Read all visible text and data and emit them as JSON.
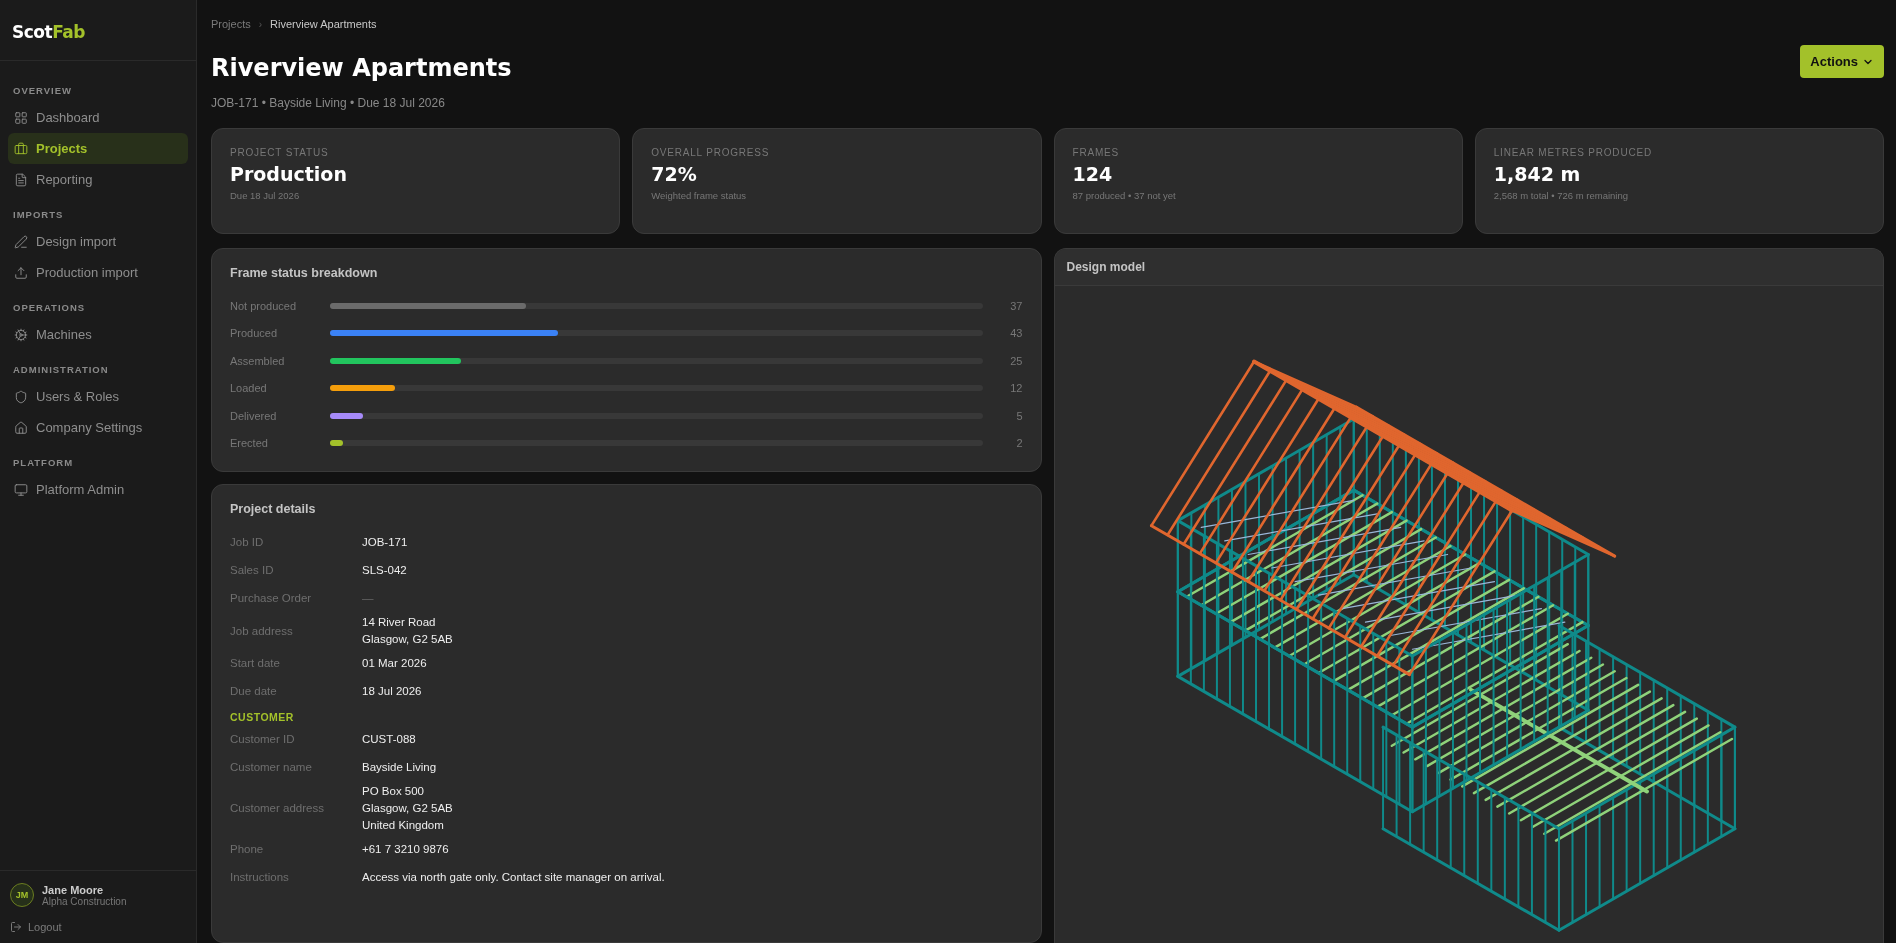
{
  "sidebar": {
    "logo": {
      "first": "Scot",
      "second": "Fab"
    },
    "sections": [
      {
        "title": "OVERVIEW",
        "items": [
          {
            "label": "Dashboard",
            "selected": false
          },
          {
            "label": "Projects",
            "selected": true
          },
          {
            "label": "Reporting",
            "selected": false
          }
        ]
      },
      {
        "title": "IMPORTS",
        "items": [
          {
            "label": "Design import",
            "selected": false
          },
          {
            "label": "Production import",
            "selected": false
          }
        ]
      },
      {
        "title": "OPERATIONS",
        "items": [
          {
            "label": "Machines",
            "selected": false
          }
        ]
      },
      {
        "title": "ADMINISTRATION",
        "items": [
          {
            "label": "Users & Roles",
            "selected": false
          },
          {
            "label": "Company Settings",
            "selected": false
          }
        ]
      },
      {
        "title": "PLATFORM",
        "items": [
          {
            "label": "Platform Admin",
            "selected": false
          }
        ]
      }
    ],
    "user": {
      "initials": "JM",
      "name": "Jane Moore",
      "company": "Alpha Construction"
    },
    "logout": "Logout"
  },
  "breadcrumb": [
    "Projects",
    "Riverview Apartments"
  ],
  "breadcrumb_separator": "›",
  "title": "Riverview Apartments",
  "subtitle": "JOB-171 • Bayside Living • Due 18 Jul 2026",
  "actions_button": "Actions",
  "stats": [
    {
      "label": "PROJECT STATUS",
      "value": "Production",
      "note": "Due 18 Jul 2026"
    },
    {
      "label": "OVERALL PROGRESS",
      "value": "72%",
      "note": "Weighted frame status"
    },
    {
      "label": "FRAMES",
      "value": "124",
      "note": "87 produced • 37 not yet"
    },
    {
      "label": "LINEAR METRES PRODUCED",
      "value": "1,842 m",
      "note": "2,568 m total • 726 m remaining"
    }
  ],
  "frame_status": {
    "title": "Frame status breakdown",
    "rows": [
      {
        "label": "Not produced",
        "count": "37",
        "level": 0.3,
        "color": "#6b6b6b"
      },
      {
        "label": "Produced",
        "count": "43",
        "level": 0.35,
        "color": "#3b82f6"
      },
      {
        "label": "Assembled",
        "count": "25",
        "level": 0.2,
        "color": "#22c55e"
      },
      {
        "label": "Loaded",
        "count": "12",
        "level": 0.1,
        "color": "#f59e0b"
      },
      {
        "label": "Delivered",
        "count": "5",
        "level": 0.05,
        "color": "#a78bfa"
      },
      {
        "label": "Erected",
        "count": "2",
        "level": 0.02,
        "color": "#a3c12a"
      }
    ]
  },
  "project_details": {
    "title": "Project details",
    "rows": [
      {
        "kind": "field",
        "label": "Job ID",
        "lines": [
          "JOB-171"
        ]
      },
      {
        "kind": "field",
        "label": "Sales ID",
        "lines": [
          "SLS-042"
        ]
      },
      {
        "kind": "empty",
        "label": "Purchase Order",
        "lines": [
          "—"
        ]
      },
      {
        "kind": "field",
        "label": "Job address",
        "lines": [
          "14 River Road",
          "Glasgow, G2 5AB"
        ]
      },
      {
        "kind": "field",
        "label": "Start date",
        "lines": [
          "01 Mar 2026"
        ]
      },
      {
        "kind": "field",
        "label": "Due date",
        "lines": [
          "18 Jul 2026"
        ]
      },
      {
        "kind": "section",
        "label": "CUSTOMER"
      },
      {
        "kind": "field",
        "label": "Customer ID",
        "lines": [
          "CUST-088"
        ]
      },
      {
        "kind": "field",
        "label": "Customer name",
        "lines": [
          "Bayside Living"
        ]
      },
      {
        "kind": "field",
        "label": "Customer address",
        "lines": [
          "PO Box 500",
          "Glasgow, G2 5AB",
          "United Kingdom"
        ]
      },
      {
        "kind": "field",
        "label": "Phone",
        "lines": [
          "+61 7 3210 9876"
        ]
      },
      {
        "kind": "field",
        "label": "Instructions",
        "lines": [
          "Access via north gate only. Contact site manager on arrival."
        ]
      }
    ]
  },
  "design_model": {
    "title": "Design model"
  }
}
